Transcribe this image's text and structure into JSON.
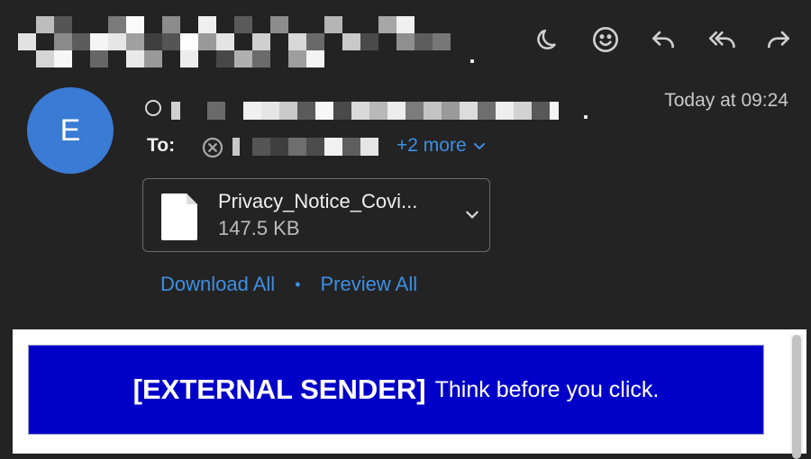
{
  "header": {
    "subject_obscured": true
  },
  "toolbar": {
    "items": [
      {
        "name": "moon-icon"
      },
      {
        "name": "emoji-icon"
      },
      {
        "name": "reply-icon"
      },
      {
        "name": "reply-all-icon"
      },
      {
        "name": "forward-icon"
      }
    ]
  },
  "sender": {
    "avatar_initial": "E",
    "date": "Today at 09:24"
  },
  "recipients": {
    "to_label": "To:",
    "more_label": "+2 more"
  },
  "attachment": {
    "name": "Privacy_Notice_Covi...",
    "size": "147.5 KB"
  },
  "actions": {
    "download_all": "Download All",
    "separator": "•",
    "preview_all": "Preview All"
  },
  "banner": {
    "strong": "[EXTERNAL SENDER]",
    "text": "Think before you click."
  },
  "colors": {
    "background": "#232323",
    "accent": "#3d8fe5",
    "avatar": "#3a7bd5",
    "banner": "#0000c8"
  }
}
